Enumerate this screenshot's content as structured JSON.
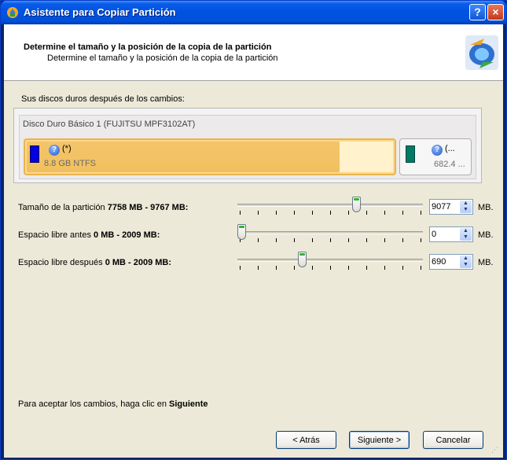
{
  "window": {
    "title": "Asistente para Copiar Partición",
    "help_label": "?",
    "close_label": "×"
  },
  "header": {
    "title": "Determine el tamaño y la posición de la copia de la partición",
    "subtitle": "Determine el tamaño y la posición de la copia de la partición"
  },
  "disks": {
    "caption": "Sus discos duros después de los cambios:",
    "disk_name": "Disco Duro Básico 1 (FUJITSU MPF3102AT)",
    "partitions": [
      {
        "label": "(*)",
        "info": "8.8 GB NTFS",
        "color": "#0000e0"
      },
      {
        "label": "(...",
        "info": "682.4 ...",
        "color": "#007a64"
      }
    ]
  },
  "size_settings": {
    "rows": [
      {
        "label": "Tamaño de la partición",
        "range": "7758 MB - 9767 MB:",
        "value": "9077",
        "unit": "MB.",
        "slider_level": 0.65
      },
      {
        "label": "Espacio libre antes",
        "range": "0 MB - 2009 MB:",
        "value": "0",
        "unit": "MB.",
        "slider_level": 0.0
      },
      {
        "label": "Espacio libre después",
        "range": "0 MB - 2009 MB:",
        "value": "690",
        "unit": "MB.",
        "slider_level": 0.34
      }
    ]
  },
  "footer": {
    "hint_prefix": "Para aceptar los cambios, haga clic en",
    "hint_bold": "Siguiente"
  },
  "buttons": {
    "back": "< Atrás",
    "next": "Siguiente >",
    "cancel": "Cancelar"
  },
  "colors": {
    "titlebar": "#0053e1",
    "dialog_bg": "#ece9d8",
    "partition_selected": "#f0c060"
  }
}
